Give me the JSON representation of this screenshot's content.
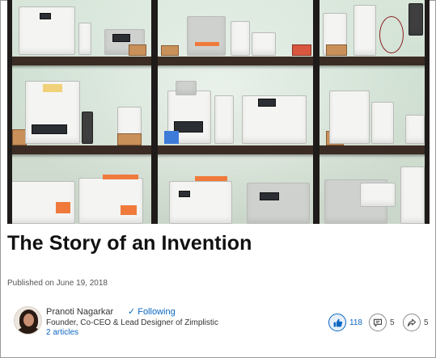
{
  "article": {
    "title": "The Story of an Invention",
    "published": "Published on June 19, 2018"
  },
  "author": {
    "name": "Pranoti Nagarkar",
    "following_label": "Following",
    "role": "Founder, Co-CEO & Lead Designer of Zimplistic",
    "articles_label": "2 articles"
  },
  "social": {
    "likes": "118",
    "comments": "5",
    "shares": "5"
  },
  "icons": {
    "following": "check-icon",
    "like": "thumbs-up-icon",
    "comment": "comment-icon",
    "share": "share-arrow-icon"
  },
  "colors": {
    "link_blue": "#0a66c2",
    "shelf_brown": "#3a2c24",
    "accent_orange": "#ef7a3c"
  }
}
